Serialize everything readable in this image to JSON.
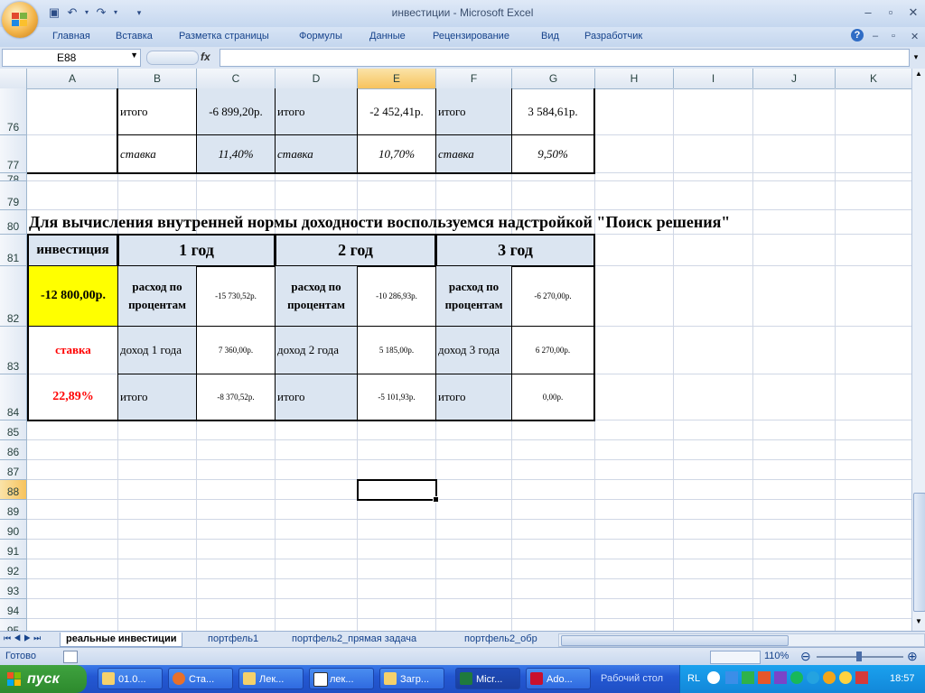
{
  "window": {
    "title": "инвестиции - Microsoft Excel",
    "controls": {
      "minimize": "–",
      "restore": "▫",
      "close": "✕"
    }
  },
  "quick_access": {
    "save_icon": "save-icon",
    "undo_icon": "undo-icon",
    "redo_icon": "redo-icon"
  },
  "ribbon": {
    "tabs": [
      "Главная",
      "Вставка",
      "Разметка страницы",
      "Формулы",
      "Данные",
      "Рецензирование",
      "Вид",
      "Разработчик"
    ],
    "help": "?"
  },
  "formula_bar": {
    "name_box": "E88",
    "fx": "fx",
    "value": ""
  },
  "columns": [
    "A",
    "B",
    "C",
    "D",
    "E",
    "F",
    "G",
    "H",
    "I",
    "J",
    "K"
  ],
  "selected_column": "E",
  "rows": [
    "76",
    "77",
    "78",
    "79",
    "80",
    "81",
    "82",
    "83",
    "84",
    "85",
    "86",
    "87",
    "88",
    "89",
    "90",
    "91",
    "92",
    "93",
    "94",
    "95"
  ],
  "selected_row": "88",
  "table_top": {
    "row76": {
      "b": "итого",
      "c": "-6 899,20р.",
      "d": "итого",
      "e": "-2 452,41р.",
      "f": "итого",
      "g": "3 584,61р."
    },
    "row77": {
      "b": "ставка",
      "c": "11,40%",
      "d": "ставка",
      "e": "10,70%",
      "f": "ставка",
      "g": "9,50%"
    }
  },
  "heading": "Для вычисления внутренней нормы доходности воспользуемся надстройкой \"Поиск решения\"",
  "table_main": {
    "header": {
      "a": "инвестиция",
      "y1": "1 год",
      "y2": "2 год",
      "y3": "3 год"
    },
    "row82": {
      "a": "-12 800,00р.",
      "b": "расход по процентам",
      "c": "-15 730,52р.",
      "d": "расход по процентам",
      "e": "-10 286,93р.",
      "f": "расход по процентам",
      "g": "-6 270,00р."
    },
    "row83": {
      "a": "ставка",
      "b": "доход 1 года",
      "c": "7 360,00р.",
      "d": "доход 2 года",
      "e": "5 185,00р.",
      "f": "доход 3 года",
      "g": "6 270,00р."
    },
    "row84": {
      "a": "22,89%",
      "b": "итого",
      "c": "-8 370,52р.",
      "d": "итого",
      "e": "-5 101,93р.",
      "f": "итого",
      "g": "0,00р."
    }
  },
  "sheet_tabs": [
    "реальные инвестиции",
    "портфель1",
    "портфель2_прямая задача",
    "портфель2_обр"
  ],
  "active_sheet": "реальные инвестиции",
  "status": {
    "ready": "Готово",
    "zoom": "110%"
  },
  "taskbar": {
    "start": "пуск",
    "items": [
      "01.0...",
      "Ста...",
      "Лек...",
      "лек...",
      "Загр...",
      "Micr...",
      "Ado..."
    ],
    "desktop": "Рабочий стол",
    "lang": "RL",
    "clock": "18:57"
  },
  "colors": {
    "yellow_fill": "#ffff00",
    "blue_fill": "#dbe5f1",
    "red_text": "#ff0000",
    "selection": "#f7c35d"
  }
}
